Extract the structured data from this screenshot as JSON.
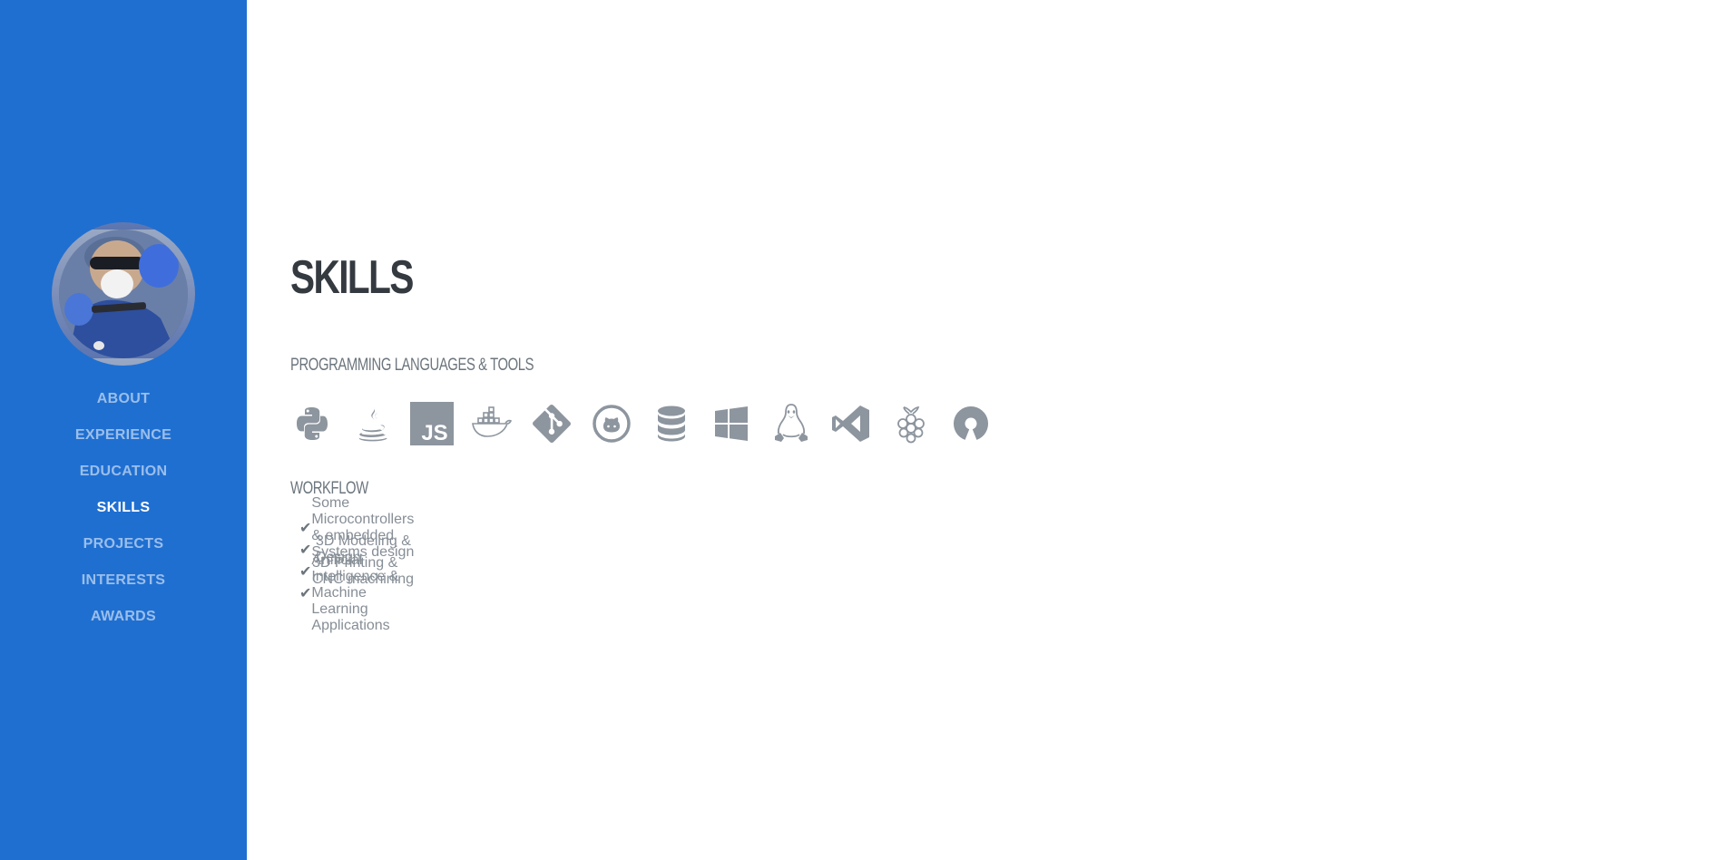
{
  "nav": {
    "items": [
      {
        "label": "ABOUT",
        "active": false
      },
      {
        "label": "EXPERIENCE",
        "active": false
      },
      {
        "label": "EDUCATION",
        "active": false
      },
      {
        "label": "SKILLS",
        "active": true
      },
      {
        "label": "PROJECTS",
        "active": false
      },
      {
        "label": "INTERESTS",
        "active": false
      },
      {
        "label": "AWARDS",
        "active": false
      }
    ]
  },
  "section": {
    "title": "SKILLS",
    "tools_heading": "PROGRAMMING LANGUAGES & TOOLS",
    "workflow_heading": "WORKFLOW",
    "tool_icons": [
      "python-icon",
      "java-icon",
      "javascript-icon",
      "docker-icon",
      "git-icon",
      "github-icon",
      "database-icon",
      "windows-icon",
      "linux-icon",
      "visual-studio-icon",
      "raspberry-pi-icon",
      "open-source-icon"
    ],
    "js_label": "JS",
    "workflow_items": [
      "Some Microcontrollers & embedded Systems design",
      "3D Modeling & Design",
      "3D Printing & CNC machining",
      "Artificial Intelligence & Machine Learning Applications"
    ],
    "check_glyph": "✔"
  },
  "colors": {
    "sidebar": "#1f6fd1",
    "title": "#343a40",
    "muted": "#6c757d",
    "icon": "#8d959e"
  }
}
